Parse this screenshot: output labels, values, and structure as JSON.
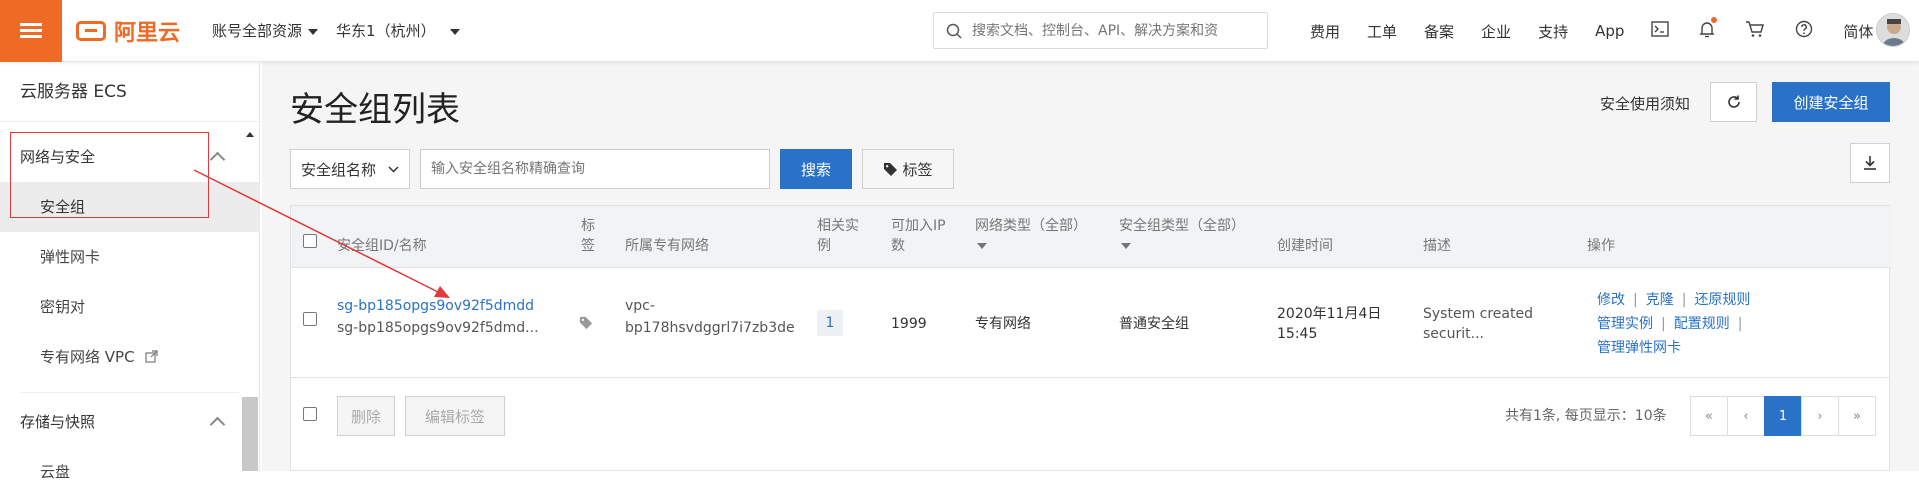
{
  "topbar": {
    "logo_text": "阿里云",
    "account": "账号全部资源",
    "region": "华东1（杭州）",
    "search_placeholder": "搜索文档、控制台、API、解决方案和资",
    "nav": [
      "费用",
      "工单",
      "备案",
      "企业",
      "支持",
      "App"
    ],
    "lang": "简体"
  },
  "sidebar": {
    "title": "云服务器 ECS",
    "section1": "网络与安全",
    "items": [
      "安全组",
      "弹性网卡",
      "密钥对",
      "专有网络 VPC"
    ],
    "section2": "存储与快照",
    "item_partial": "云盘"
  },
  "page": {
    "title": "安全组列表",
    "notice": "安全使用须知",
    "create_button": "创建安全组"
  },
  "filter": {
    "select_value": "安全组名称",
    "input_placeholder": "输入安全组名称精确查询",
    "search_button": "搜索",
    "tag_button": "标签"
  },
  "table": {
    "headers": {
      "id": "安全组ID/名称",
      "tag": "标签",
      "vpc": "所属专有网络",
      "related": "相关实例",
      "ip": "可加入IP数",
      "net_type": "网络类型（全部）",
      "sg_type": "安全组类型（全部）",
      "created": "创建时间",
      "desc": "描述",
      "ops": "操作"
    },
    "row": {
      "id": "sg-bp185opgs9ov92f5dmdd",
      "name": "sg-bp185opgs9ov92f5dmd...",
      "vpc_line1": "vpc-",
      "vpc_line2": "bp178hsvdggrl7i7zb3de",
      "related": "1",
      "ip": "1999",
      "net_type": "专有网络",
      "sg_type": "普通安全组",
      "created_line1": "2020年11月4日",
      "created_line2": "15:45",
      "desc_line1": "System created",
      "desc_line2": "securit...",
      "ops": [
        "修改",
        "克隆",
        "还原规则",
        "管理实例",
        "配置规则",
        "管理弹性网卡"
      ]
    },
    "footer": {
      "delete": "删除",
      "edit_tags": "编辑标签",
      "summary": "共有1条, 每页显示：10条",
      "pages": [
        "«",
        "‹",
        "1",
        "›",
        "»"
      ]
    }
  },
  "colors": {
    "brand": "#ef6a24",
    "primary": "#2a72c8",
    "annotation": "#e03a3a"
  }
}
